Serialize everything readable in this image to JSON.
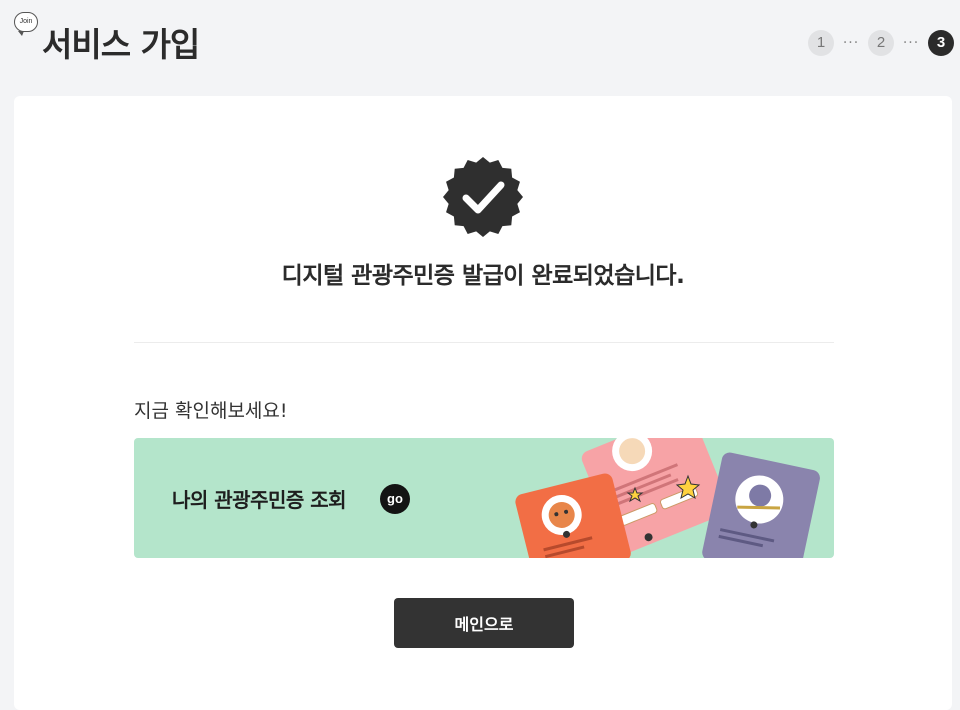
{
  "header": {
    "badge": "Join",
    "title": "서비스 가입",
    "steps": [
      {
        "label": "1",
        "active": false
      },
      {
        "label": "2",
        "active": false
      },
      {
        "label": "3",
        "active": true
      }
    ],
    "step_separator": "···"
  },
  "main": {
    "icon": "check-badge-icon",
    "complete_message": "디지털 관광주민증 발급이 완료되었습니다.",
    "check_now": "지금 확인해보세요!",
    "banner": {
      "label": "나의 관광주민증 조회",
      "go_label": "go",
      "background": "#b4e5cb"
    },
    "main_button": "메인으로"
  },
  "colors": {
    "page_bg": "#f3f4f6",
    "card_bg": "#ffffff",
    "dark": "#333333",
    "banner_bg": "#b4e5cb",
    "illus_pink": "#f7a3a6",
    "illus_orange": "#f26e45",
    "illus_purple": "#8a84ad"
  }
}
